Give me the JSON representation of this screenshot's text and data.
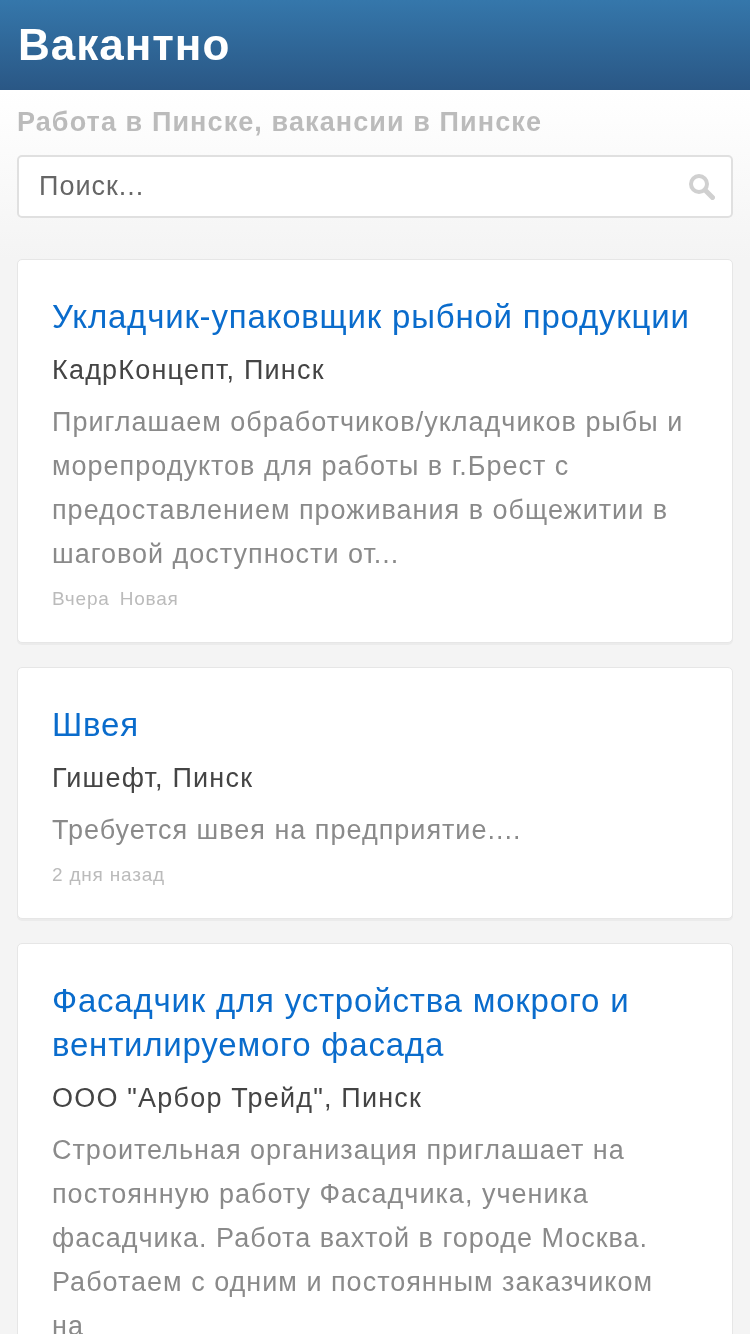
{
  "header": {
    "title": "Вакантно"
  },
  "subtitle": "Работа в Пинске, вакансии в Пинске",
  "search": {
    "placeholder": "Поиск..."
  },
  "vacancies": [
    {
      "title": "Укладчик-упаковщик рыбной продукции",
      "company": "КадрКонцепт, Пинск",
      "description": "Приглашаем обработчиков/укладчиков рыбы и морепродуктов для работы в г.Брест с предоставлением проживания в общежитии в шаговой доступности от...",
      "date": "Вчера",
      "tags": [
        "Новая"
      ]
    },
    {
      "title": "Швея",
      "company": "Гишефт, Пинск",
      "description": "Требуется швея на предприятие....",
      "date": "2 дня назад"
    },
    {
      "title": "Фасадчик для устройства мокрого и вентилируемого фасада",
      "company": "ООО \"Арбор Трейд\", Пинск",
      "description": "Строительная организация приглашает на постоянную работу Фасадчика, ученика фасадчика. Работа вахтой в городе Москва. Работаем с одним и постоянным заказчиком на"
    }
  ]
}
